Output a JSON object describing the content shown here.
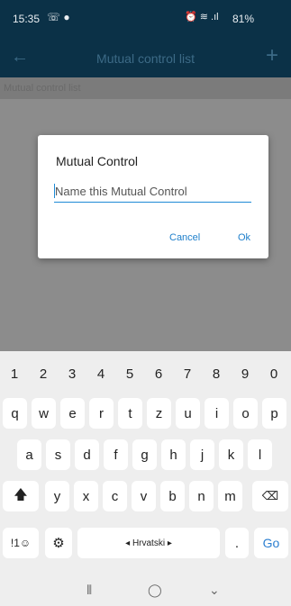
{
  "status_bar": {
    "time": "15:35",
    "left_icons": "☏ ●",
    "right_icons": "⏰ ≋ .ıl",
    "battery": "81%"
  },
  "app_bar": {
    "back_icon": "back-arrow-icon",
    "title": "Mutual control list",
    "add_icon": "plus-icon"
  },
  "subheader": {
    "label": "Mutual control list"
  },
  "dialog": {
    "title": "Mutual Control",
    "input_placeholder": "Name this Mutual Control",
    "cancel_label": "Cancel",
    "ok_label": "Ok"
  },
  "keyboard": {
    "row_numbers": [
      "1",
      "2",
      "3",
      "4",
      "5",
      "6",
      "7",
      "8",
      "9",
      "0"
    ],
    "row1": [
      "q",
      "w",
      "e",
      "r",
      "t",
      "z",
      "u",
      "i",
      "o",
      "p"
    ],
    "row2": [
      "a",
      "s",
      "d",
      "f",
      "g",
      "h",
      "j",
      "k",
      "l"
    ],
    "row3": [
      "y",
      "x",
      "c",
      "v",
      "b",
      "n",
      "m"
    ],
    "symbols_label": "!1☺",
    "space_label": "◂ Hrvatski ▸",
    "period_label": ".",
    "go_label": "Go"
  },
  "colors": {
    "app_bar_bg": "#0b3147",
    "accent": "#1e8ad6"
  }
}
